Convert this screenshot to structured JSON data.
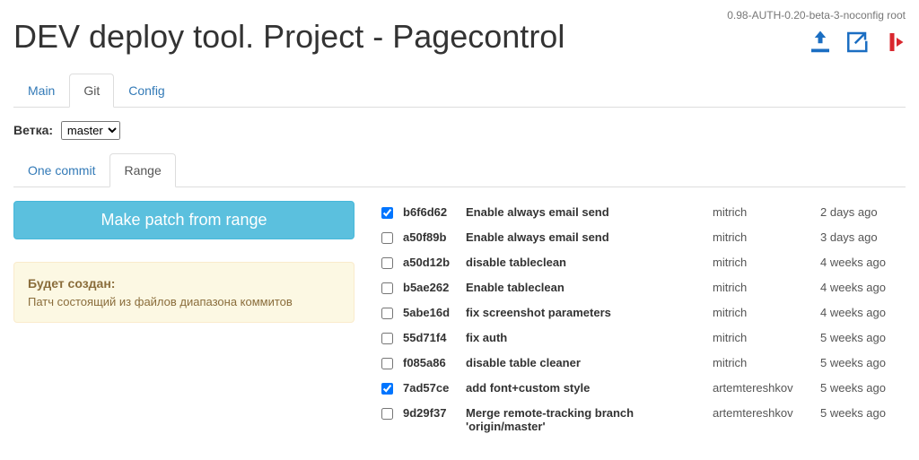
{
  "header": {
    "title": "DEV deploy tool. Project - Pagecontrol",
    "version": "0.98-AUTH-0.20-beta-3-noconfig root"
  },
  "tabs_main": [
    {
      "label": "Main",
      "active": false
    },
    {
      "label": "Git",
      "active": true
    },
    {
      "label": "Config",
      "active": false
    }
  ],
  "branch": {
    "label": "Ветка:",
    "selected": "master"
  },
  "tabs_sub": [
    {
      "label": "One commit",
      "active": false
    },
    {
      "label": "Range",
      "active": true
    }
  ],
  "action_button": "Make patch from range",
  "info_panel": {
    "title": "Будет создан:",
    "body": "Патч состоящий из файлов диапазона коммитов"
  },
  "commits": [
    {
      "checked": true,
      "hash": "b6f6d62",
      "msg": "Enable always email send",
      "author": "mitrich",
      "date": "2 days ago"
    },
    {
      "checked": false,
      "hash": "a50f89b",
      "msg": "Enable always email send",
      "author": "mitrich",
      "date": "3 days ago"
    },
    {
      "checked": false,
      "hash": "a50d12b",
      "msg": "disable tableclean",
      "author": "mitrich",
      "date": "4 weeks ago"
    },
    {
      "checked": false,
      "hash": "b5ae262",
      "msg": "Enable tableclean",
      "author": "mitrich",
      "date": "4 weeks ago"
    },
    {
      "checked": false,
      "hash": "5abe16d",
      "msg": "fix screenshot parameters",
      "author": "mitrich",
      "date": "4 weeks ago"
    },
    {
      "checked": false,
      "hash": "55d71f4",
      "msg": "fix auth",
      "author": "mitrich",
      "date": "5 weeks ago"
    },
    {
      "checked": false,
      "hash": "f085a86",
      "msg": "disable table cleaner",
      "author": "mitrich",
      "date": "5 weeks ago"
    },
    {
      "checked": true,
      "hash": "7ad57ce",
      "msg": "add font+custom style",
      "author": "artemtereshkov",
      "date": "5 weeks ago"
    },
    {
      "checked": false,
      "hash": "9d29f37",
      "msg": "Merge remote-tracking branch 'origin/master'",
      "author": "artemtereshkov",
      "date": "5 weeks ago"
    }
  ]
}
